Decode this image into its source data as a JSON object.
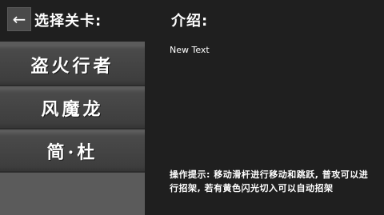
{
  "header": {
    "back_icon": "←",
    "select_title": "选择关卡:",
    "intro_title": "介绍:"
  },
  "levels": [
    {
      "label": "盗火行者"
    },
    {
      "label": "风魔龙"
    },
    {
      "label": "简·杜"
    }
  ],
  "detail": {
    "description": "New Text",
    "hint": "操作提示: 移动滑杆进行移动和跳跃, 普攻可以进行招架, 若有黄色闪光切入可以自动招架"
  },
  "icons": {
    "back": "left-arrow-icon"
  },
  "colors": {
    "background": "#1f1f1f",
    "panel": "#5b5b5b",
    "item": "#444444",
    "text": "#ffffff"
  }
}
